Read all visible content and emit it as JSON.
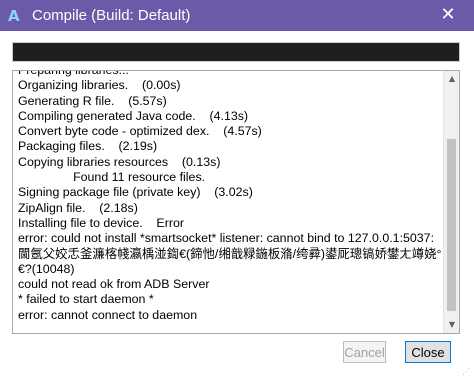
{
  "window": {
    "title": "Compile (Build: Default)",
    "app_icon_glyph": "A",
    "close_glyph": "✕",
    "titlebar_color": "#6b5aa8"
  },
  "progress": {
    "fill_fraction": 1.0
  },
  "log": {
    "lines": [
      "Preparing libraries...",
      "Organizing libraries.    (0.00s)",
      "Generating R file.    (5.57s)",
      "Compiling generated Java code.    (4.13s)",
      "Convert byte code - optimized dex.    (4.57s)",
      "Packaging files.    (2.19s)",
      "Copying libraries resources    (0.13s)",
      "                Found 11 resource files.",
      "Signing package file (private key)    (3.02s)",
      "ZipAlign file.    (2.18s)",
      "Installing file to device.    Error",
      "error: could not install *smartsocket* listener: cannot bind to 127.0.0.1:5037:",
      "閫氬父姣忎釜濂楁帴瀛楀湴鍧€(鍗忚/缃戠粶鍦板潃/绔彛)鍙厑璁镐娇鐢ㄤ竴娆°€",
      "€?(10048)",
      "could not read ok from ADB Server",
      "* failed to start daemon *",
      "error: cannot connect to daemon"
    ]
  },
  "buttons": {
    "cancel_label": "Cancel",
    "close_label": "Close"
  },
  "scrollbar": {
    "up_glyph": "▲",
    "down_glyph": "▼"
  }
}
